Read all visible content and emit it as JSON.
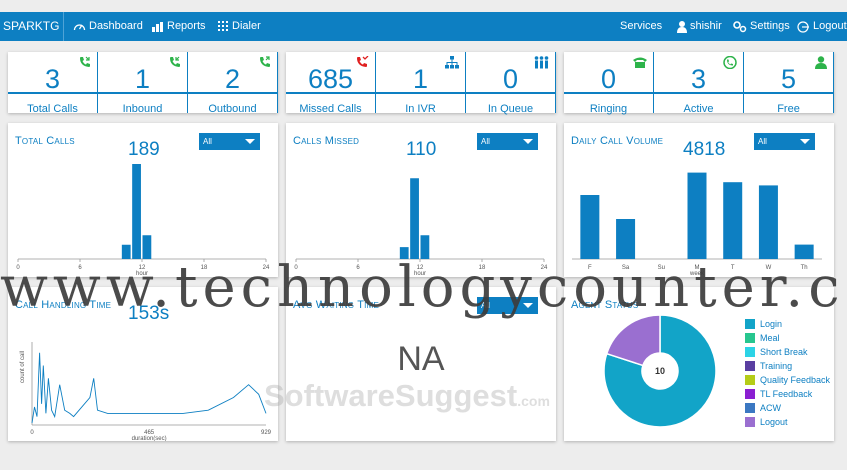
{
  "nav": {
    "brand": "SPARKTG",
    "dashboard": "Dashboard",
    "reports": "Reports",
    "dialer": "Dialer",
    "services": "Services",
    "user": "shishir",
    "settings": "Settings",
    "logout": "Logout"
  },
  "stats": [
    {
      "value": "3",
      "label": "Total Calls",
      "icon": "phone-incoming-icon"
    },
    {
      "value": "1",
      "label": "Inbound",
      "icon": "phone-inbound-icon"
    },
    {
      "value": "2",
      "label": "Outbound",
      "icon": "phone-outbound-icon"
    },
    {
      "value": "685",
      "label": "Missed Calls",
      "icon": "phone-missed-icon"
    },
    {
      "value": "1",
      "label": "In IVR",
      "icon": "ivr-tree-icon"
    },
    {
      "value": "0",
      "label": "In Queue",
      "icon": "queue-people-icon"
    },
    {
      "value": "0",
      "label": "Ringing",
      "icon": "ringing-phone-icon"
    },
    {
      "value": "3",
      "label": "Active",
      "icon": "active-call-icon"
    },
    {
      "value": "5",
      "label": "Free",
      "icon": "free-agent-icon"
    }
  ],
  "colors": {
    "accent": "#0d7fc2",
    "green": "#2db34a",
    "red": "#e02020",
    "pie_login": "#12a4c8",
    "pie_logout": "#9a6fd0"
  },
  "panels": {
    "total_calls": {
      "title": "Total Calls",
      "total": "189",
      "select": "All"
    },
    "calls_missed": {
      "title": "Calls Missed",
      "total": "110",
      "select": "All"
    },
    "daily_volume": {
      "title": "Daily Call Volume",
      "total": "4818",
      "select": "All"
    },
    "handling": {
      "title": "Call Handling Time",
      "total": "153s"
    },
    "avg_waiting": {
      "title": "Avg Waiting Time",
      "select": "All",
      "value": "NA"
    },
    "agent_status": {
      "title": "Agent Status",
      "center": "10"
    }
  },
  "chart_data": [
    {
      "type": "bar",
      "title": "Total Calls",
      "xlabel": "hour",
      "xticks": [
        "0",
        "6",
        "12",
        "18",
        "24"
      ],
      "xlim": [
        0,
        24
      ],
      "x": [
        10,
        11,
        12
      ],
      "values": [
        12,
        80,
        20
      ]
    },
    {
      "type": "bar",
      "title": "Calls Missed",
      "xlabel": "hour",
      "xticks": [
        "0",
        "6",
        "12",
        "18",
        "24"
      ],
      "xlim": [
        0,
        24
      ],
      "x": [
        10,
        11,
        12
      ],
      "values": [
        10,
        68,
        20
      ]
    },
    {
      "type": "bar",
      "title": "Daily Call Volume",
      "xlabel": "week",
      "categories": [
        "F",
        "Sa",
        "Su",
        "M",
        "T",
        "W",
        "Th"
      ],
      "values": [
        800,
        500,
        0,
        1080,
        960,
        920,
        180
      ]
    },
    {
      "type": "line",
      "title": "Call Handling Time",
      "xlabel": "duration(sec)",
      "ylabel": "count of call",
      "xticks": [
        "0",
        "465",
        "929"
      ],
      "xlim": [
        0,
        929
      ],
      "points": [
        [
          0,
          0
        ],
        [
          10,
          5
        ],
        [
          20,
          2
        ],
        [
          30,
          22
        ],
        [
          38,
          6
        ],
        [
          45,
          18
        ],
        [
          55,
          3
        ],
        [
          65,
          14
        ],
        [
          78,
          4
        ],
        [
          90,
          2
        ],
        [
          110,
          12
        ],
        [
          130,
          4
        ],
        [
          150,
          3
        ],
        [
          165,
          2
        ],
        [
          230,
          8
        ],
        [
          245,
          14
        ],
        [
          260,
          4
        ],
        [
          300,
          3
        ],
        [
          400,
          3
        ],
        [
          600,
          3
        ],
        [
          700,
          4
        ],
        [
          800,
          8
        ],
        [
          860,
          12
        ],
        [
          900,
          9
        ],
        [
          929,
          3
        ]
      ]
    },
    {
      "type": "pie",
      "title": "Agent Status",
      "labels": [
        "Login",
        "Meal",
        "Short Break",
        "Training",
        "Quality Feedback",
        "TL Feedback",
        "ACW",
        "Logout"
      ],
      "colors": [
        "#12a4c8",
        "#27c68f",
        "#2cd3e6",
        "#5a3ea1",
        "#b5cc18",
        "#8b1fd1",
        "#3b78c2",
        "#9a6fd0"
      ],
      "values": [
        8,
        0,
        0,
        0,
        0,
        0,
        0,
        2
      ]
    }
  ],
  "watermark": {
    "line1": "www.technologycounter.co",
    "line2": "SoftwareSuggest",
    "line2_suffix": ".com"
  }
}
